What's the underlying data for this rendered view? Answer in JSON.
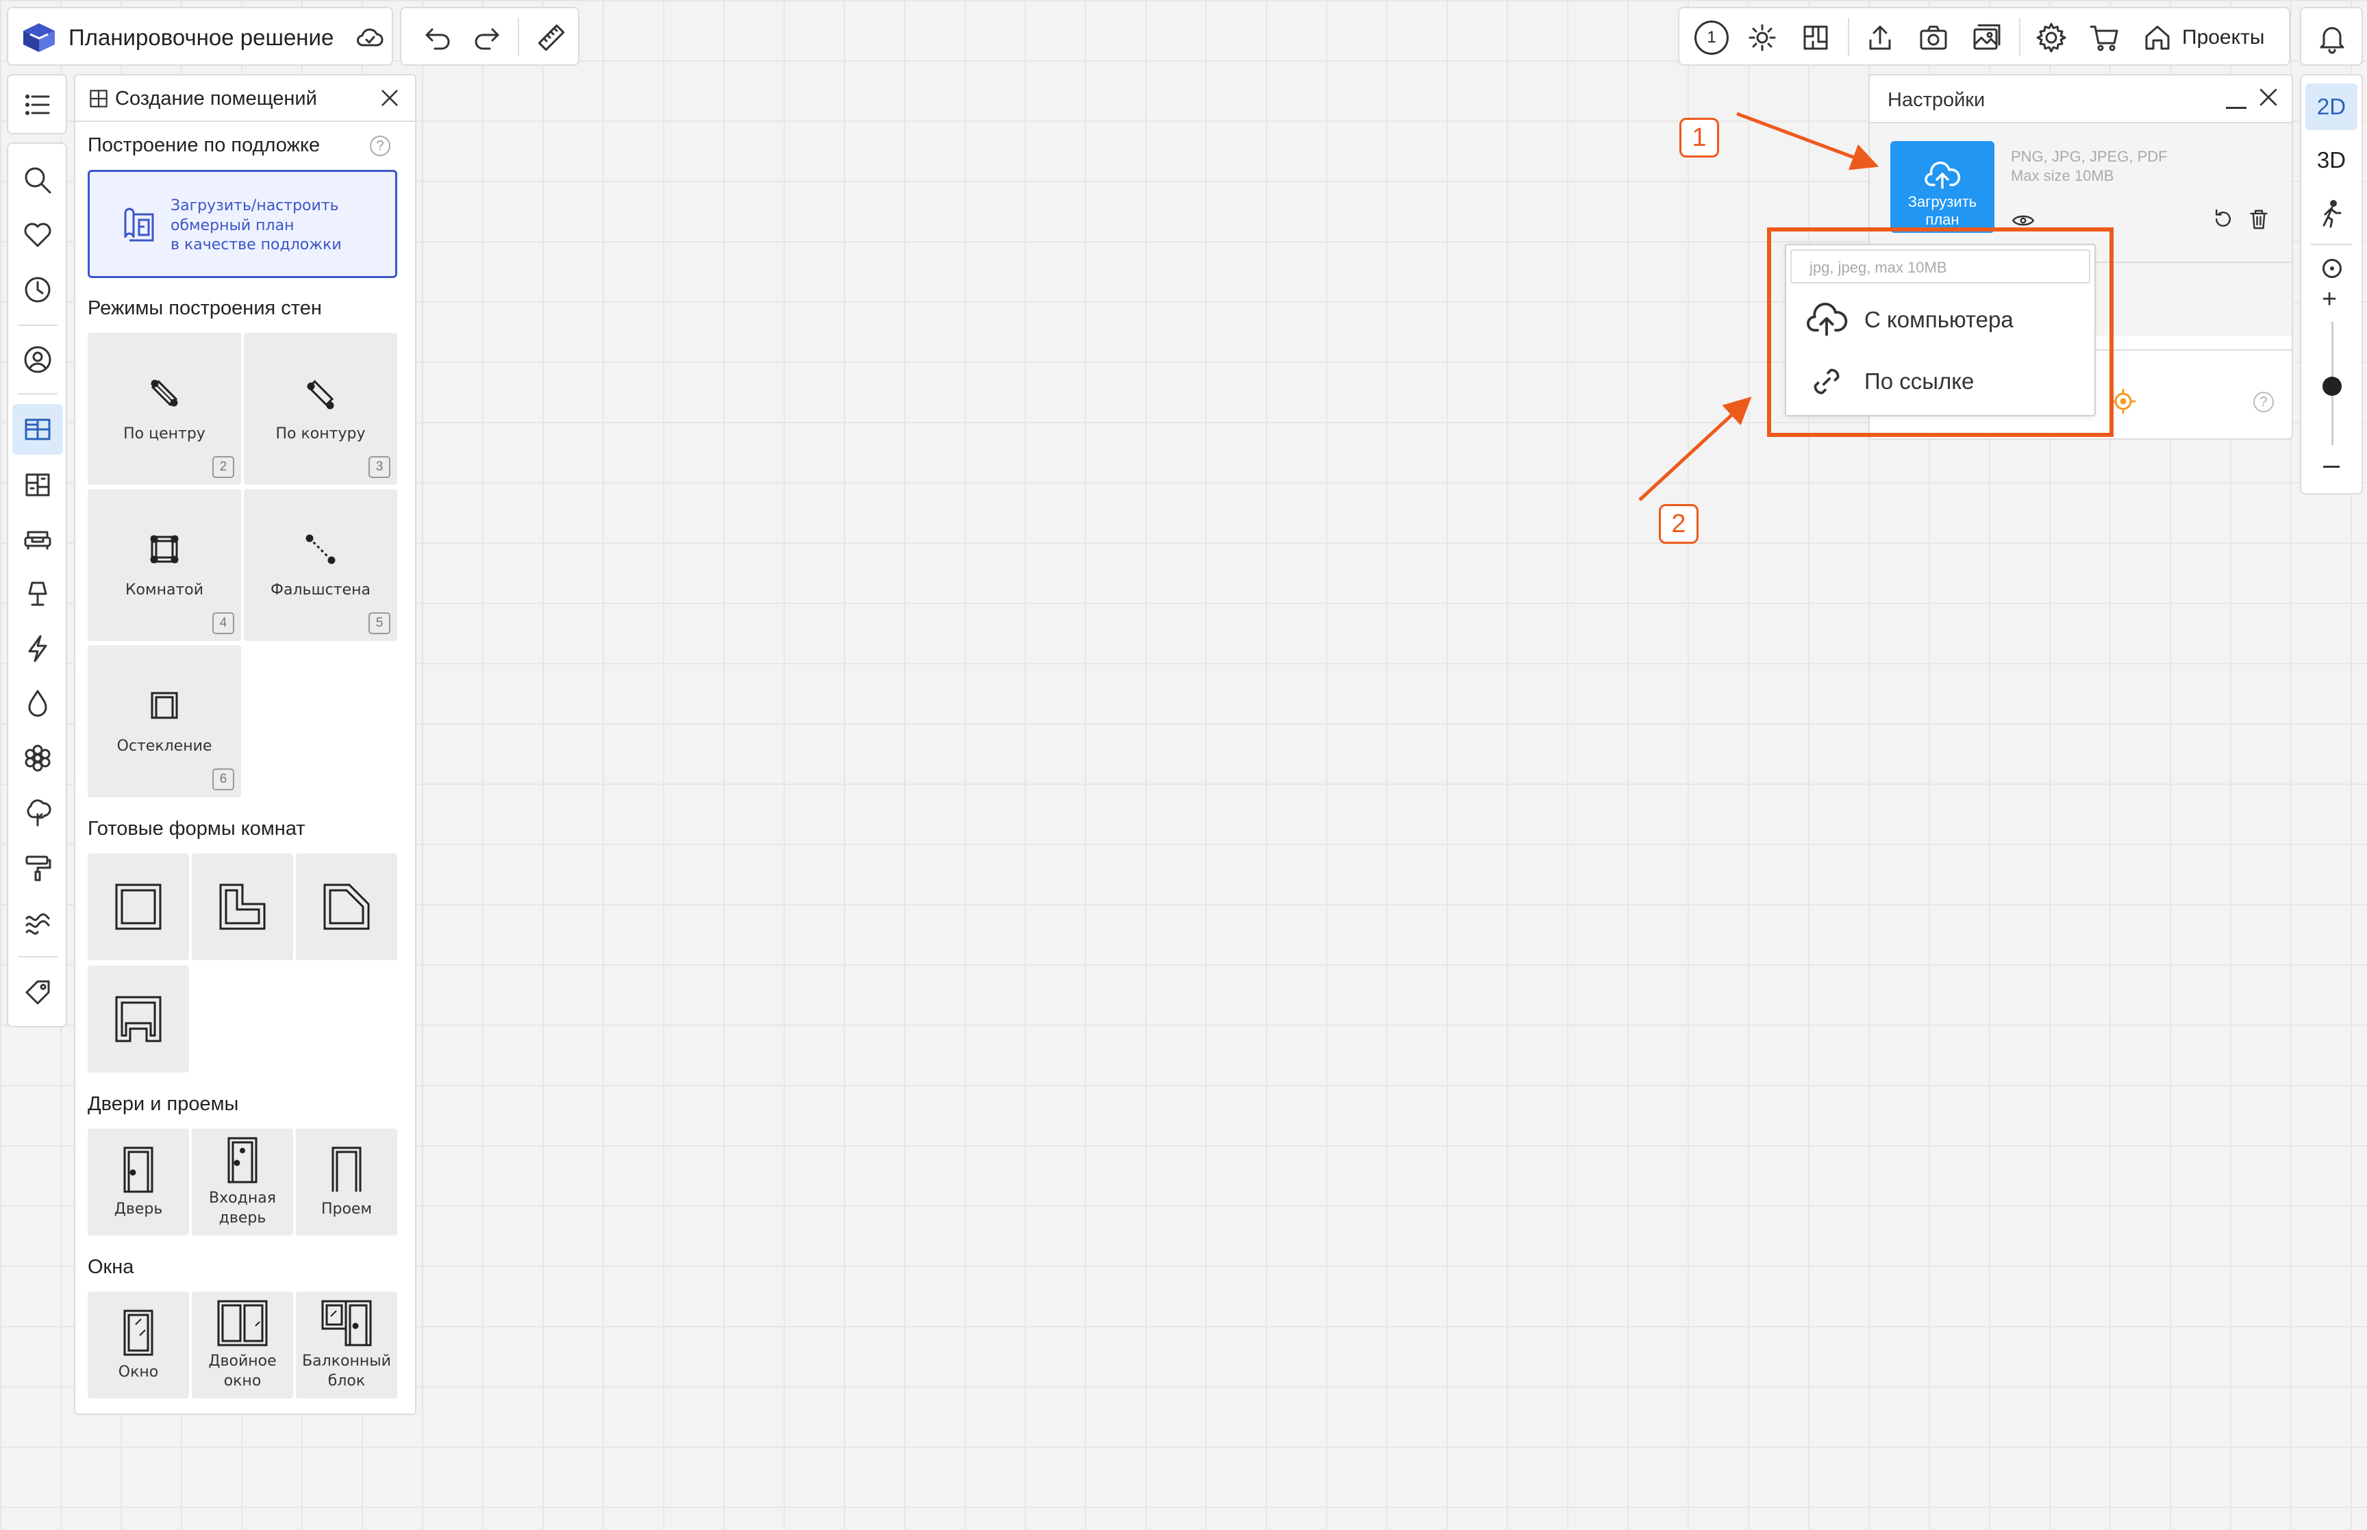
{
  "app": {
    "title": "Планировочное решение"
  },
  "topbar": {
    "projects_label": "Проекты",
    "level_number": "1"
  },
  "panel": {
    "title": "Создание помещений",
    "underlay_section": "Построение по подложке",
    "upload_text_1": "Загрузить/настроить",
    "upload_text_2": "обмерный план",
    "upload_text_3": "в качестве подложки",
    "walls_section": "Режимы построения стен",
    "wall_modes": [
      {
        "label": "По центру",
        "key": "2",
        "icon": "wall-center-icon"
      },
      {
        "label": "По контуру",
        "key": "3",
        "icon": "wall-contour-icon"
      },
      {
        "label": "Комнатой",
        "key": "4",
        "icon": "room-icon"
      },
      {
        "label": "Фальшстена",
        "key": "5",
        "icon": "false-wall-icon"
      },
      {
        "label": "Остекление",
        "key": "6",
        "icon": "glazing-icon"
      }
    ],
    "shapes_section": "Готовые формы комнат",
    "doors_section": "Двери и проемы",
    "doors": [
      {
        "label": "Дверь",
        "icon": "door-icon"
      },
      {
        "label_1": "Входная",
        "label_2": "дверь",
        "icon": "entrance-door-icon"
      },
      {
        "label": "Проем",
        "icon": "opening-icon"
      }
    ],
    "windows_section": "Окна",
    "windows": [
      {
        "label": "Окно",
        "icon": "window-icon"
      },
      {
        "label_1": "Двойное",
        "label_2": "окно",
        "icon": "double-window-icon"
      },
      {
        "label_1": "Балконный",
        "label_2": "блок",
        "icon": "balcony-block-icon"
      }
    ]
  },
  "settings": {
    "title": "Настройки",
    "upload_btn_1": "Загрузить",
    "upload_btn_2": "план",
    "formats": "PNG, JPG, JPEG, PDF",
    "max_size": "Max size 10MB"
  },
  "dropdown": {
    "hint": "jpg, jpeg, max 10MB",
    "from_computer": "С компьютера",
    "by_link": "По ссылке"
  },
  "view": {
    "mode_2d": "2D",
    "mode_3d": "3D",
    "zoom_level": 0.5
  },
  "annotations": {
    "badge_1": "1",
    "badge_2": "2",
    "accent": "#ee5a1c"
  },
  "colors": {
    "primary": "#2196f3",
    "accent_blue": "#3d55c7"
  }
}
